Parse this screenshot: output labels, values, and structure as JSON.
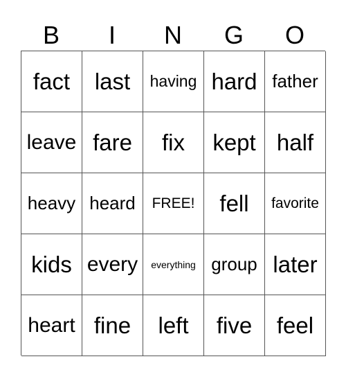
{
  "header": [
    "B",
    "I",
    "N",
    "G",
    "O"
  ],
  "rows": [
    [
      "fact",
      "last",
      "having",
      "hard",
      "father"
    ],
    [
      "leave",
      "fare",
      "fix",
      "kept",
      "half"
    ],
    [
      "heavy",
      "heard",
      "FREE!",
      "fell",
      "favorite"
    ],
    [
      "kids",
      "every",
      "everything",
      "group",
      "later"
    ],
    [
      "heart",
      "fine",
      "left",
      "five",
      "feel"
    ]
  ]
}
